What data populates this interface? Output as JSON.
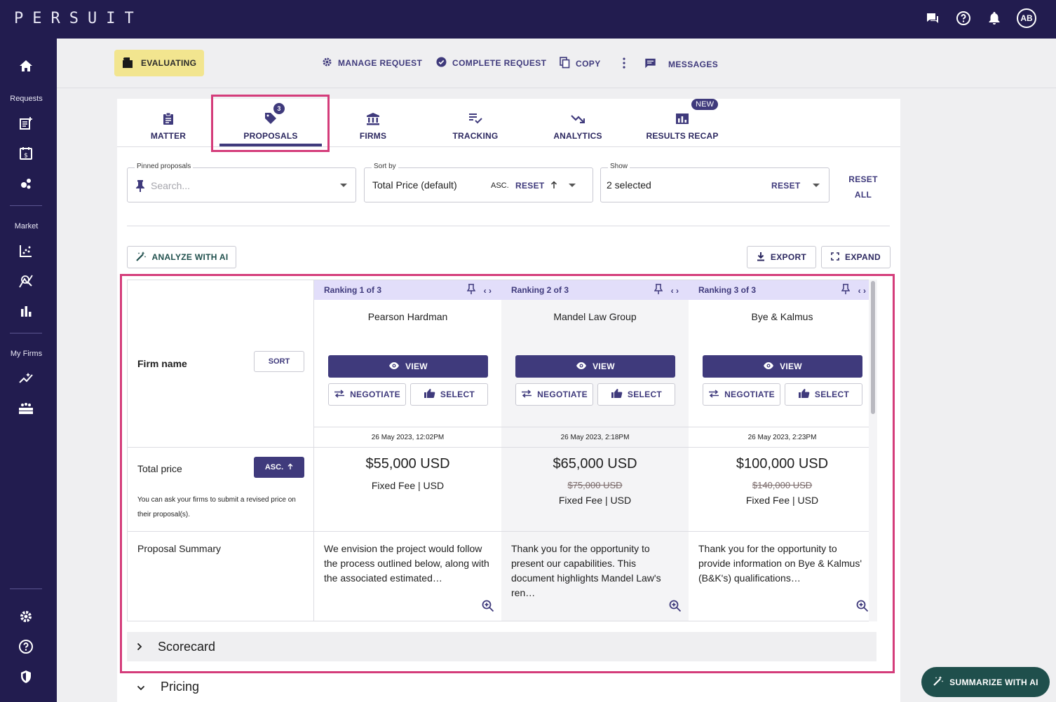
{
  "app": {
    "logo": "PERSUIT",
    "avatar_initials": "AB"
  },
  "topbar": {
    "icons": [
      "chat-icon",
      "help-icon",
      "bell-icon"
    ]
  },
  "sidebar": {
    "sections": [
      {
        "label": "Requests"
      },
      {
        "label": "Market"
      },
      {
        "label": "My Firms"
      }
    ]
  },
  "actionbar": {
    "status": "EVALUATING",
    "manage": "MANAGE REQUEST",
    "complete": "COMPLETE REQUEST",
    "copy": "COPY",
    "messages": "MESSAGES"
  },
  "tabs": [
    {
      "label": "MATTER",
      "icon": "clipboard-icon"
    },
    {
      "label": "PROPOSALS",
      "icon": "tag-icon",
      "badge": "3",
      "active": true
    },
    {
      "label": "FIRMS",
      "icon": "bank-icon"
    },
    {
      "label": "TRACKING",
      "icon": "list-check-icon"
    },
    {
      "label": "ANALYTICS",
      "icon": "trend-down-icon"
    },
    {
      "label": "RESULTS RECAP",
      "icon": "chart-doc-icon",
      "badge": "NEW"
    }
  ],
  "filters": {
    "pinned": {
      "label": "Pinned proposals",
      "placeholder": "Search..."
    },
    "sort": {
      "label": "Sort by",
      "value": "Total Price (default)",
      "order": "ASC.",
      "reset": "RESET"
    },
    "show": {
      "label": "Show",
      "value": "2 selected",
      "reset": "RESET"
    },
    "reset_all_line1": "RESET",
    "reset_all_line2": "ALL"
  },
  "toolbar": {
    "analyze": "ANALYZE WITH AI",
    "export": "EXPORT",
    "expand": "EXPAND"
  },
  "grid": {
    "row_labels": {
      "firm_name": "Firm name",
      "sort": "SORT",
      "total_price": "Total price",
      "asc": "ASC.",
      "hint": "You can ask your firms to submit a revised price on their proposal(s).",
      "summary": "Proposal Summary"
    },
    "buttons": {
      "view": "VIEW",
      "negotiate": "NEGOTIATE",
      "select": "SELECT"
    },
    "firms": [
      {
        "ranking": "Ranking 1 of 3",
        "name": "Pearson Hardman",
        "date": "26 May 2023, 12:02PM",
        "price": "$55,000 USD",
        "original_price": "",
        "fee": "Fixed Fee | USD",
        "summary": "We envision the project would follow the process outlined below, along with the associated estimated…"
      },
      {
        "ranking": "Ranking 2 of 3",
        "name": "Mandel Law Group",
        "date": "26 May 2023, 2:18PM",
        "price": "$65,000 USD",
        "original_price": "$75,000 USD",
        "fee": "Fixed Fee | USD",
        "summary": "Thank you for the opportunity to present our capabilities. This document highlights Mandel Law's ren…"
      },
      {
        "ranking": "Ranking 3 of 3",
        "name": "Bye & Kalmus",
        "date": "26 May 2023, 2:23PM",
        "price": "$100,000 USD",
        "original_price": "$140,000 USD",
        "fee": "Fixed Fee | USD",
        "summary": "Thank you for the opportunity to provide information on Bye & Kalmus' (B&K's) qualifications…"
      }
    ]
  },
  "sections": {
    "scorecard": "Scorecard",
    "pricing": "Pricing"
  },
  "fab": {
    "summarize": "SUMMARIZE WITH AI"
  },
  "colors": {
    "brand_dark": "#221c4f",
    "accent": "#3f3a7c",
    "highlight": "#d43c7a",
    "status_chip": "#f2e58f",
    "fab": "#1f4f4c"
  }
}
